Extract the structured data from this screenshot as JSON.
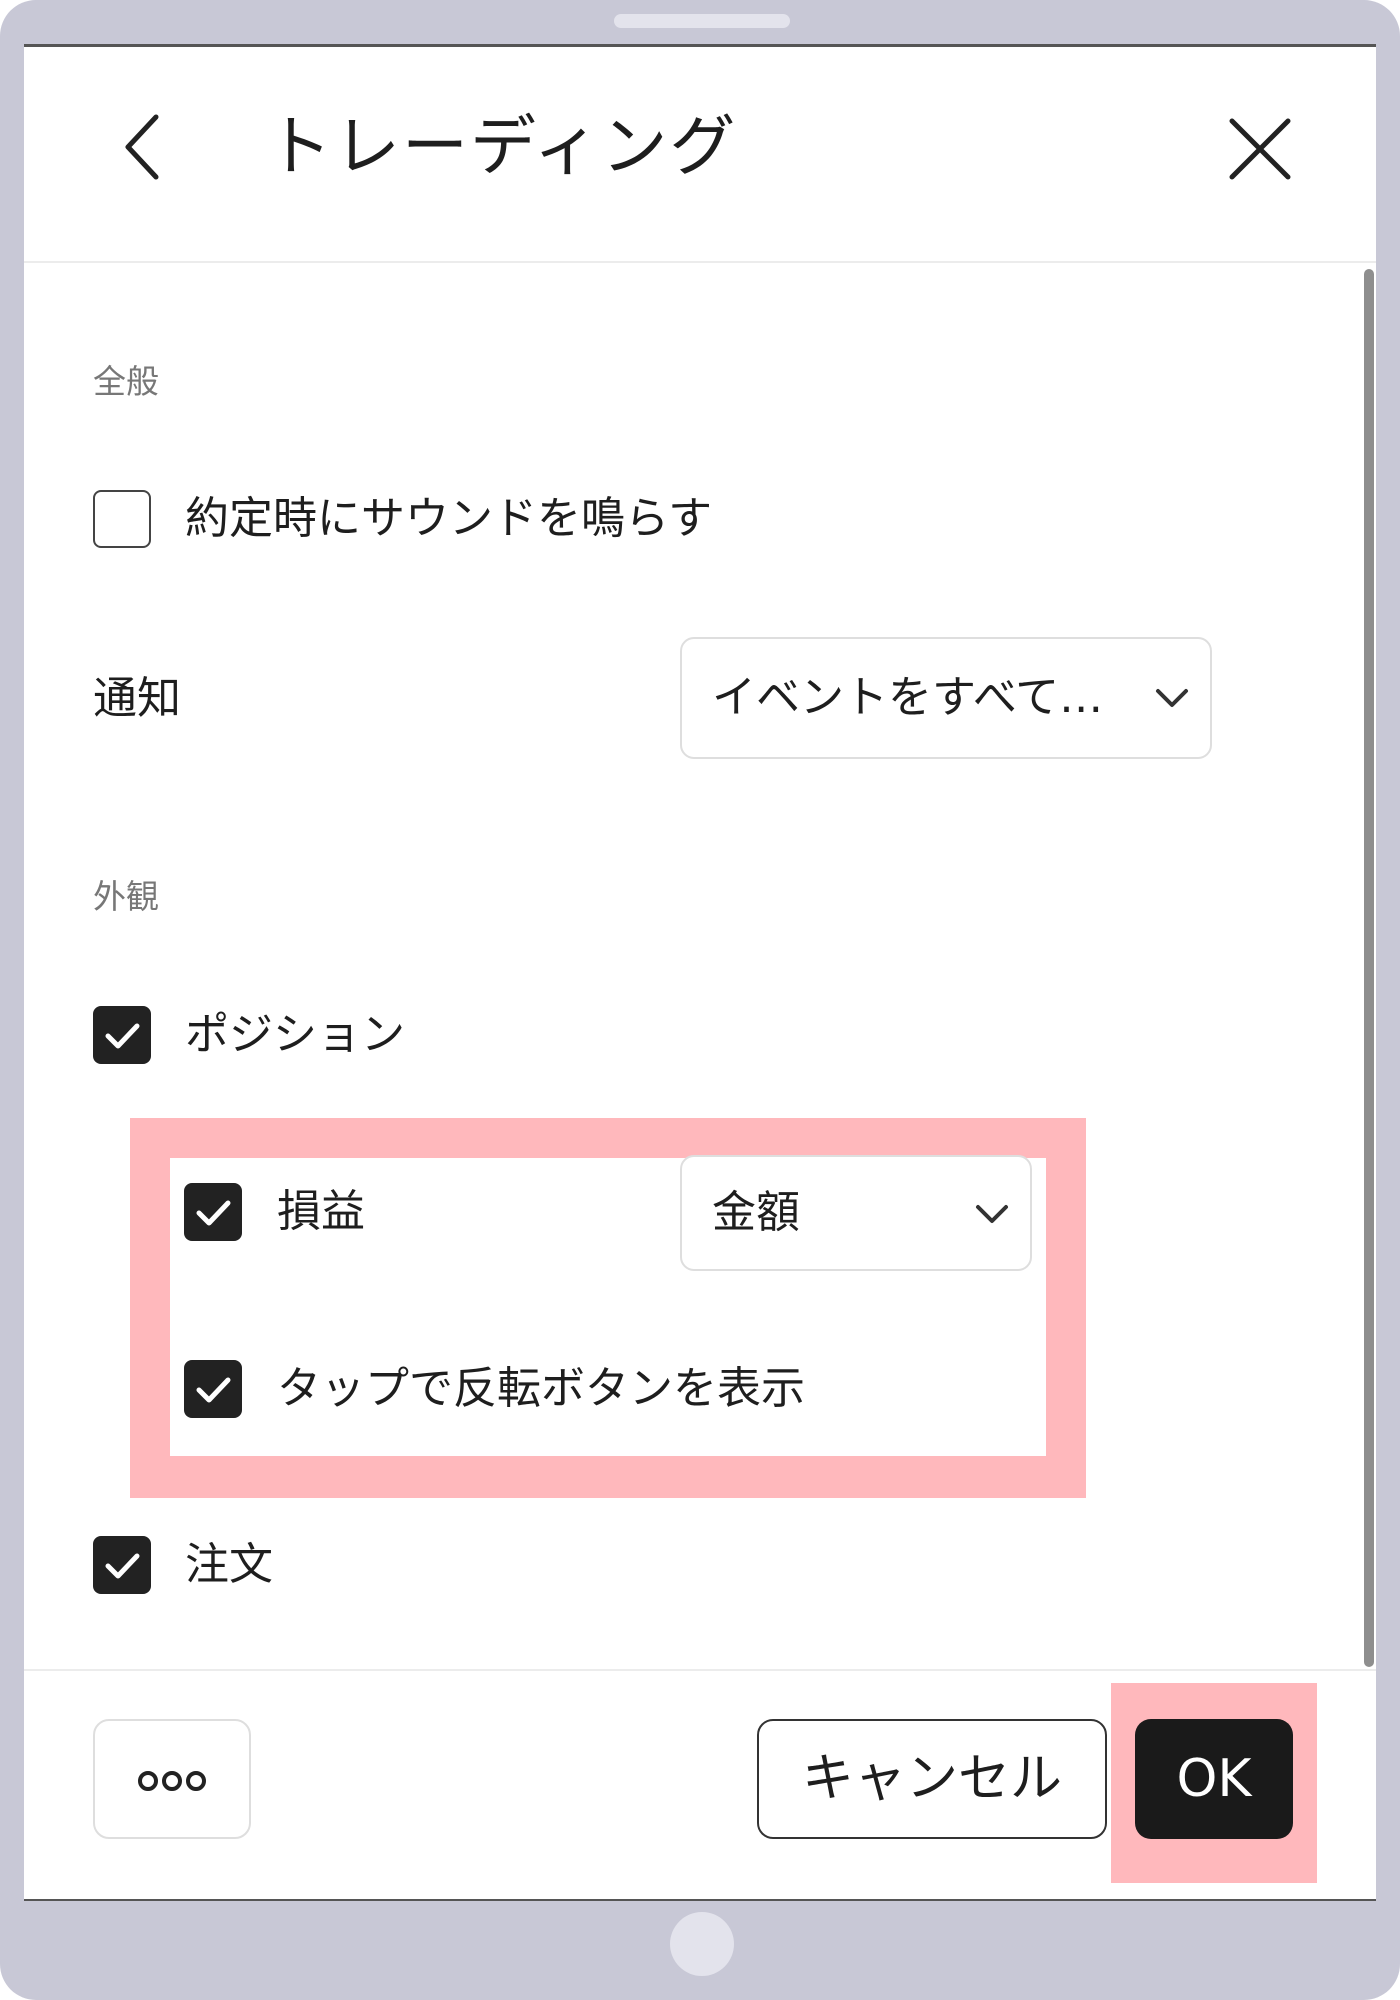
{
  "header": {
    "title": "トレーディング",
    "back_icon": "chevron-left-icon",
    "close_icon": "close-icon"
  },
  "sections": {
    "general": {
      "label": "全般",
      "sound_on_fill": {
        "label": "約定時にサウンドを鳴らす",
        "checked": false
      },
      "notification": {
        "label": "通知",
        "selected": "イベントをすべて…"
      }
    },
    "appearance": {
      "label": "外観",
      "positions": {
        "label": "ポジション",
        "checked": true
      },
      "pnl": {
        "label": "損益",
        "checked": true,
        "selected": "金額"
      },
      "reverse_button": {
        "label": "タップで反転ボタンを表示",
        "checked": true
      },
      "orders": {
        "label": "注文",
        "checked": true
      }
    }
  },
  "footer": {
    "more_label": "ooo",
    "cancel_label": "キャンセル",
    "ok_label": "OK"
  },
  "colors": {
    "highlight": "#ffb8bc",
    "checkbox_on": "#222222",
    "ok_button": "#1a1a1a"
  }
}
